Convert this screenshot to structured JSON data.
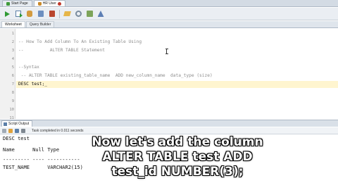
{
  "doc_tabs": [
    {
      "label": "Start Page"
    },
    {
      "label": "HR User"
    }
  ],
  "worksheet_tabs": [
    {
      "label": "Worksheet"
    },
    {
      "label": "Query Builder"
    }
  ],
  "editor": {
    "line_numbers": [
      "1",
      "2",
      "3",
      "4",
      "5",
      "6",
      "7",
      "8",
      "9",
      "10",
      "11"
    ],
    "lines": [
      "",
      "",
      "-- How To Add Column To An Existing Table Using",
      "--          ALTER TABLE Statement",
      "",
      "--Syntax",
      " -- ALTER TABLE existing_table_name  ADD new_column_name  data_type (size)",
      "DESC test;_",
      "",
      "",
      ""
    ]
  },
  "output_panel": {
    "tab_label": "Script Output",
    "status": "Task completed in 0.011 seconds",
    "lines": [
      "DESC test",
      "Name      Null Type",
      "--------- ---- -----------",
      "TEST_NAME      VARCHAR2(15)"
    ]
  },
  "caption": {
    "line1": "Now let's add the column",
    "line2": "ALTER TABLE test ADD",
    "line3": "test_id NUMBER(3);"
  },
  "colors": {
    "accent": "#2e9a35",
    "active_line": "#fff5cf",
    "comment": "#8d8d8d"
  }
}
